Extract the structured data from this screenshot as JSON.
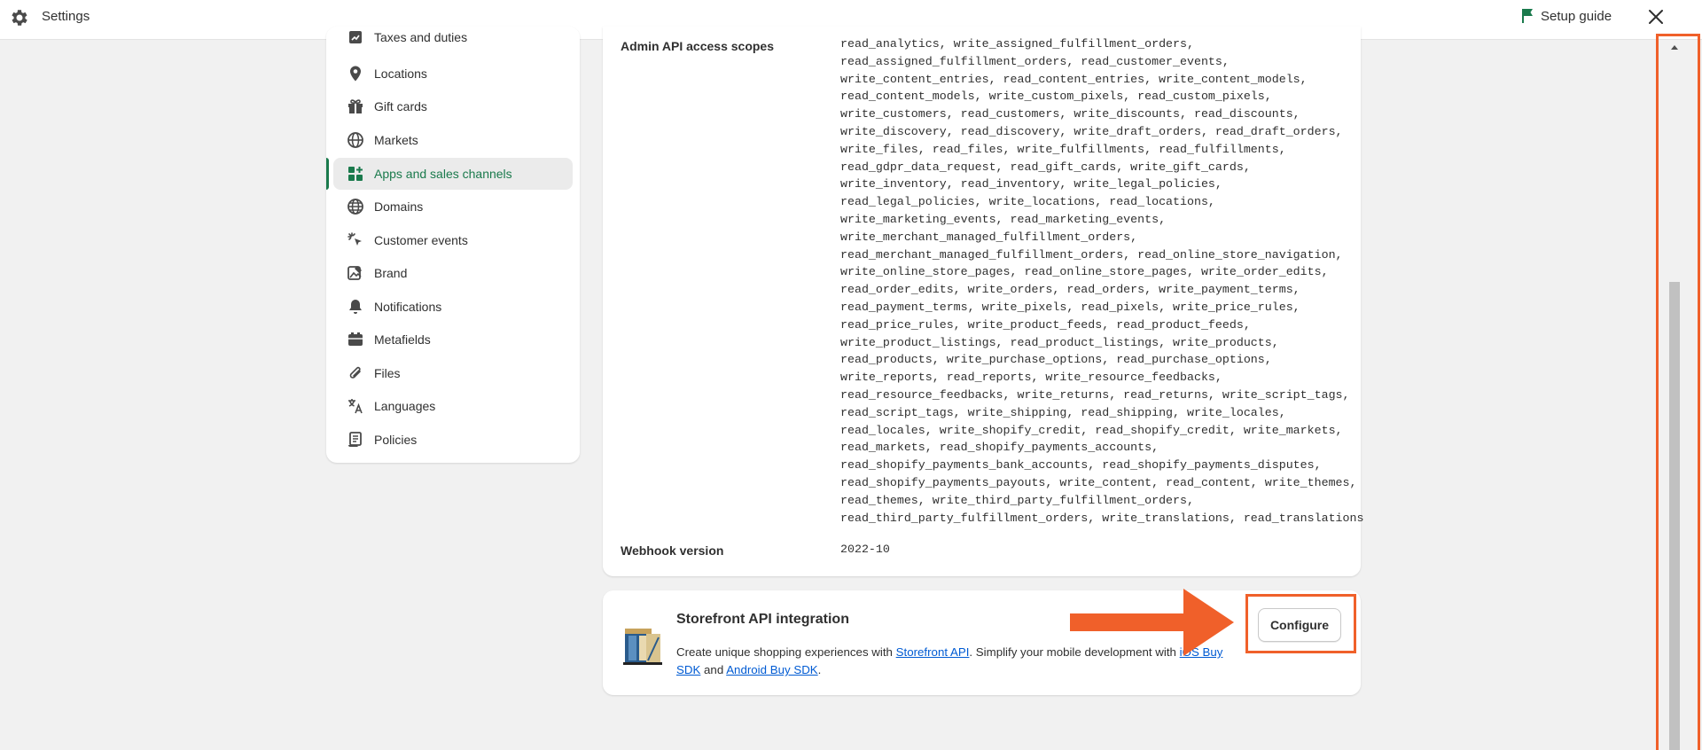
{
  "topbar": {
    "title": "Settings",
    "setup_guide": "Setup guide",
    "gear_icon": "gear-icon",
    "flag_icon": "flag-icon",
    "close_icon": "close-icon"
  },
  "sidebar": {
    "items": [
      {
        "label": "Taxes and duties",
        "icon": "taxes-icon"
      },
      {
        "label": "Locations",
        "icon": "location-pin-icon"
      },
      {
        "label": "Gift cards",
        "icon": "gift-icon"
      },
      {
        "label": "Markets",
        "icon": "globe-icon"
      },
      {
        "label": "Apps and sales channels",
        "icon": "apps-icon",
        "active": true
      },
      {
        "label": "Domains",
        "icon": "domain-globe-icon"
      },
      {
        "label": "Customer events",
        "icon": "cursor-click-icon"
      },
      {
        "label": "Brand",
        "icon": "brand-icon"
      },
      {
        "label": "Notifications",
        "icon": "bell-icon"
      },
      {
        "label": "Metafields",
        "icon": "metafields-icon"
      },
      {
        "label": "Files",
        "icon": "paperclip-icon"
      },
      {
        "label": "Languages",
        "icon": "translate-icon"
      },
      {
        "label": "Policies",
        "icon": "policy-document-icon"
      }
    ],
    "active_color": "#1a7a4c"
  },
  "details": {
    "scopes_label": "Admin API access scopes",
    "scopes_text": "read_analytics, write_assigned_fulfillment_orders,\nread_assigned_fulfillment_orders, read_customer_events,\nwrite_content_entries, read_content_entries, write_content_models,\nread_content_models, write_custom_pixels, read_custom_pixels,\nwrite_customers, read_customers, write_discounts, read_discounts,\nwrite_discovery, read_discovery, write_draft_orders, read_draft_orders,\nwrite_files, read_files, write_fulfillments, read_fulfillments,\nread_gdpr_data_request, read_gift_cards, write_gift_cards,\nwrite_inventory, read_inventory, write_legal_policies,\nread_legal_policies, write_locations, read_locations,\nwrite_marketing_events, read_marketing_events,\nwrite_merchant_managed_fulfillment_orders,\nread_merchant_managed_fulfillment_orders, read_online_store_navigation,\nwrite_online_store_pages, read_online_store_pages, write_order_edits,\nread_order_edits, write_orders, read_orders, write_payment_terms,\nread_payment_terms, write_pixels, read_pixels, write_price_rules,\nread_price_rules, write_product_feeds, read_product_feeds,\nwrite_product_listings, read_product_listings, write_products,\nread_products, write_purchase_options, read_purchase_options,\nwrite_reports, read_reports, write_resource_feedbacks,\nread_resource_feedbacks, write_returns, read_returns, write_script_tags,\nread_script_tags, write_shipping, read_shipping, write_locales,\nread_locales, write_shopify_credit, read_shopify_credit, write_markets,\nread_markets, read_shopify_payments_accounts,\nread_shopify_payments_bank_accounts, read_shopify_payments_disputes,\nread_shopify_payments_payouts, write_content, read_content, write_themes,\nread_themes, write_third_party_fulfillment_orders,\nread_third_party_fulfillment_orders, write_translations, read_translations",
    "webhook_label": "Webhook version",
    "webhook_value": "2022-10"
  },
  "storefront": {
    "title": "Storefront API integration",
    "icon": "storefront-app-icon",
    "desc_1": "Create unique shopping experiences with ",
    "link_storefront": "Storefront API",
    "desc_2": ". Simplify your mobile development with ",
    "link_ios": "iOS Buy SDK",
    "desc_3": " and ",
    "link_android": "Android Buy SDK",
    "desc_4": ".",
    "configure_label": "Configure"
  },
  "annotations": {
    "highlight_color": "#f0602a"
  }
}
